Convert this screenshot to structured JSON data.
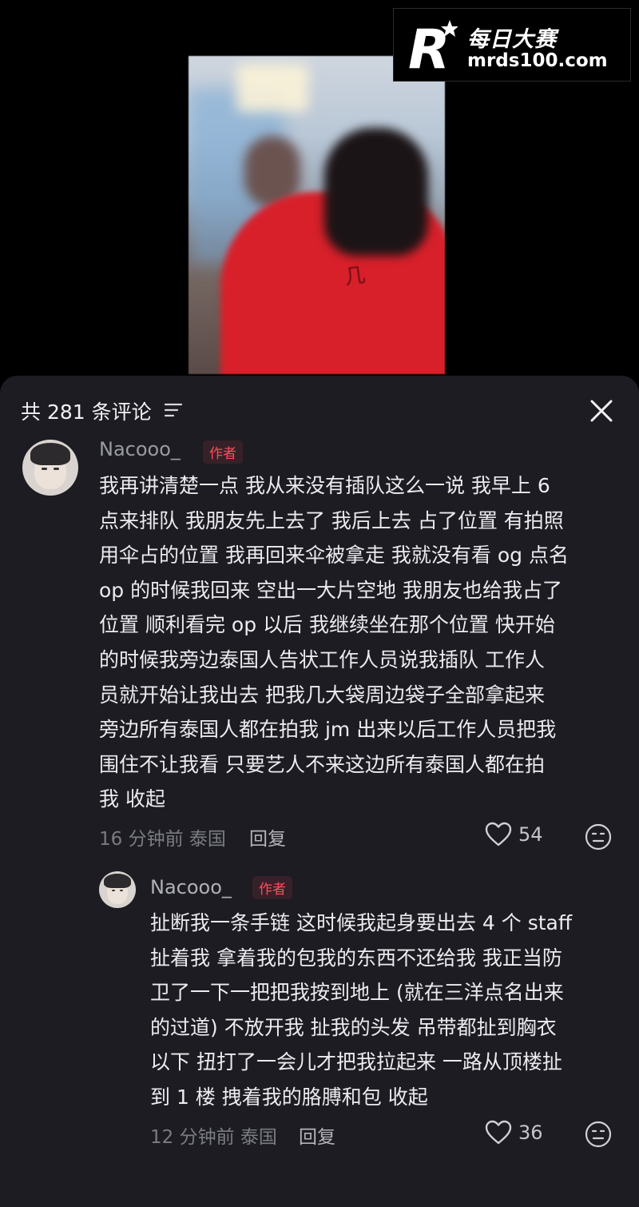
{
  "watermark": {
    "brand_cn": "每日大赛",
    "url": "mrds100.com",
    "logo_letter": "R"
  },
  "video": {
    "jersey_mark": "几"
  },
  "header": {
    "comment_count_label": "共 281 条评论"
  },
  "comments": [
    {
      "username": "Nacooo_",
      "badge": "作者",
      "lines": [
        "我再讲清楚一点 我从来没有插队这么一说 我早上 6",
        "点来排队 我朋友先上去了 我后上去 占了位置 有拍照",
        "用伞占的位置 我再回来伞被拿走 我就没有看 og 点名",
        "op 的时候我回来 空出一大片空地 我朋友也给我占了",
        "位置 顺利看完 op 以后 我继续坐在那个位置 快开始",
        "的时候我旁边泰国人告状工作人员说我插队 工作人",
        "员就开始让我出去 把我几大袋周边袋子全部拿起来",
        "旁边所有泰国人都在拍我 jm 出来以后工作人员把我",
        "围住不让我看 只要艺人不来这边所有泰国人都在拍",
        "我 收起"
      ],
      "time": "16 分钟前",
      "location": "泰国",
      "reply_label": "回复",
      "likes": "54"
    },
    {
      "username": "Nacooo_",
      "badge": "作者",
      "lines": [
        "扯断我一条手链 这时候我起身要出去 4 个 staff",
        "扯着我 拿着我的包我的东西不还给我 我正当防",
        "卫了一下一把把我按到地上 (就在三洋点名出来",
        "的过道) 不放开我 扯我的头发 吊带都扯到胸衣",
        "以下 扭打了一会儿才把我拉起来 一路从顶楼扯",
        "到 1 楼 拽着我的胳膊和包 收起"
      ],
      "time": "12 分钟前",
      "location": "泰国",
      "reply_label": "回复",
      "likes": "36"
    }
  ],
  "colors": {
    "panel_bg": "#1c1c22",
    "badge_red": "#ff4d5e",
    "text_primary": "#ececef",
    "text_secondary": "#7b7b84"
  },
  "icons": [
    "filter-icon",
    "close-icon",
    "heart-icon",
    "emoji-icon"
  ]
}
